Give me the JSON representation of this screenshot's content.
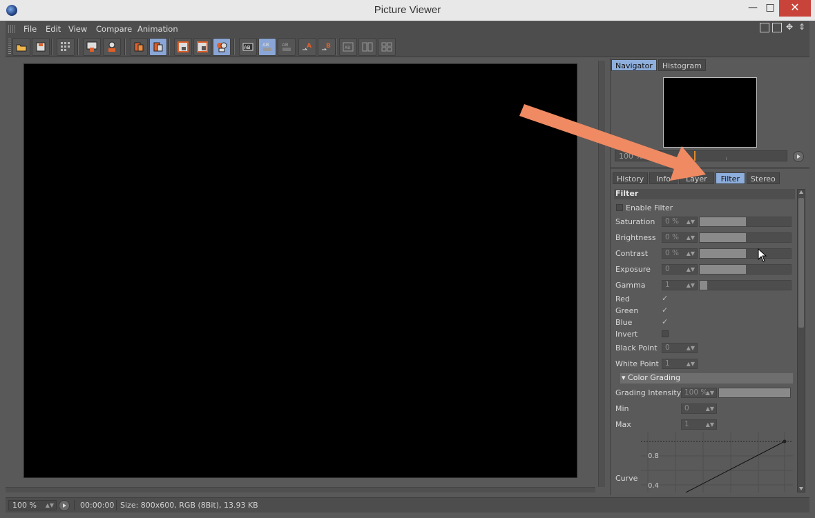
{
  "window": {
    "title": "Picture Viewer",
    "controls": {
      "minimize": "—",
      "maximize": "□",
      "close": "✕"
    }
  },
  "menu": [
    "File",
    "Edit",
    "View",
    "Compare",
    "Animation"
  ],
  "toolbar": {
    "buttons": [
      {
        "icon": "open-file-icon"
      },
      {
        "icon": "save-file-icon"
      },
      {
        "icon": "grid-icon"
      },
      {
        "icon": "render-region-icon"
      },
      {
        "icon": "person-export-icon"
      },
      {
        "icon": "copy-layers-icon"
      },
      {
        "icon": "paste-layers-icon",
        "active": true
      },
      {
        "icon": "view-a-icon"
      },
      {
        "icon": "view-b-icon"
      },
      {
        "icon": "view-ab-icon",
        "active": true
      },
      {
        "icon": "ab-compare-icon"
      },
      {
        "icon": "ab-split-icon",
        "active": true
      },
      {
        "icon": "ab-toggle-icon"
      },
      {
        "icon": "set-a-icon"
      },
      {
        "icon": "set-b-icon"
      },
      {
        "icon": "layout-1-icon"
      },
      {
        "icon": "layout-2-icon"
      },
      {
        "icon": "layout-3-icon"
      }
    ]
  },
  "navigator": {
    "tabs": [
      "Navigator",
      "Histogram"
    ],
    "active_tab": "Navigator",
    "zoom": "100 %"
  },
  "panel_tabs": {
    "tabs": [
      "History",
      "Info",
      "Layer",
      "Filter",
      "Stereo"
    ],
    "active_tab": "Filter"
  },
  "filter": {
    "heading": "Filter",
    "enable_label": "Enable Filter",
    "enabled": false,
    "sliders": [
      {
        "label": "Saturation",
        "value": "0 %",
        "level": 0.5
      },
      {
        "label": "Brightness",
        "value": "0 %",
        "level": 0.5
      },
      {
        "label": "Contrast",
        "value": "0 %",
        "level": 0.5
      },
      {
        "label": "Exposure",
        "value": "0",
        "level": 0.5
      },
      {
        "label": "Gamma",
        "value": "1",
        "level": 0.08
      }
    ],
    "channels": [
      {
        "label": "Red",
        "checked": true
      },
      {
        "label": "Green",
        "checked": true
      },
      {
        "label": "Blue",
        "checked": true
      },
      {
        "label": "Invert",
        "checked": false
      }
    ],
    "black_point": {
      "label": "Black Point",
      "value": "0"
    },
    "white_point": {
      "label": "White Point",
      "value": "1"
    },
    "color_grading": {
      "heading": "Color Grading",
      "intensity": {
        "label": "Grading Intensity",
        "value": "100 %",
        "level": 1.0
      },
      "min": {
        "label": "Min",
        "value": "0"
      },
      "max": {
        "label": "Max",
        "value": "1"
      }
    },
    "curve": {
      "label": "Curve",
      "ticks": [
        "0.8",
        "0.4"
      ]
    }
  },
  "status": {
    "zoom": "100 %",
    "time": "00:00:00",
    "info": "Size: 800x600, RGB (8Bit), 13.93 KB"
  },
  "colors": {
    "accent_tab": "#8eaedc",
    "annotation_arrow": "#f08a62",
    "close_button": "#c8443a",
    "zoom_marker": "#e08a2e"
  }
}
